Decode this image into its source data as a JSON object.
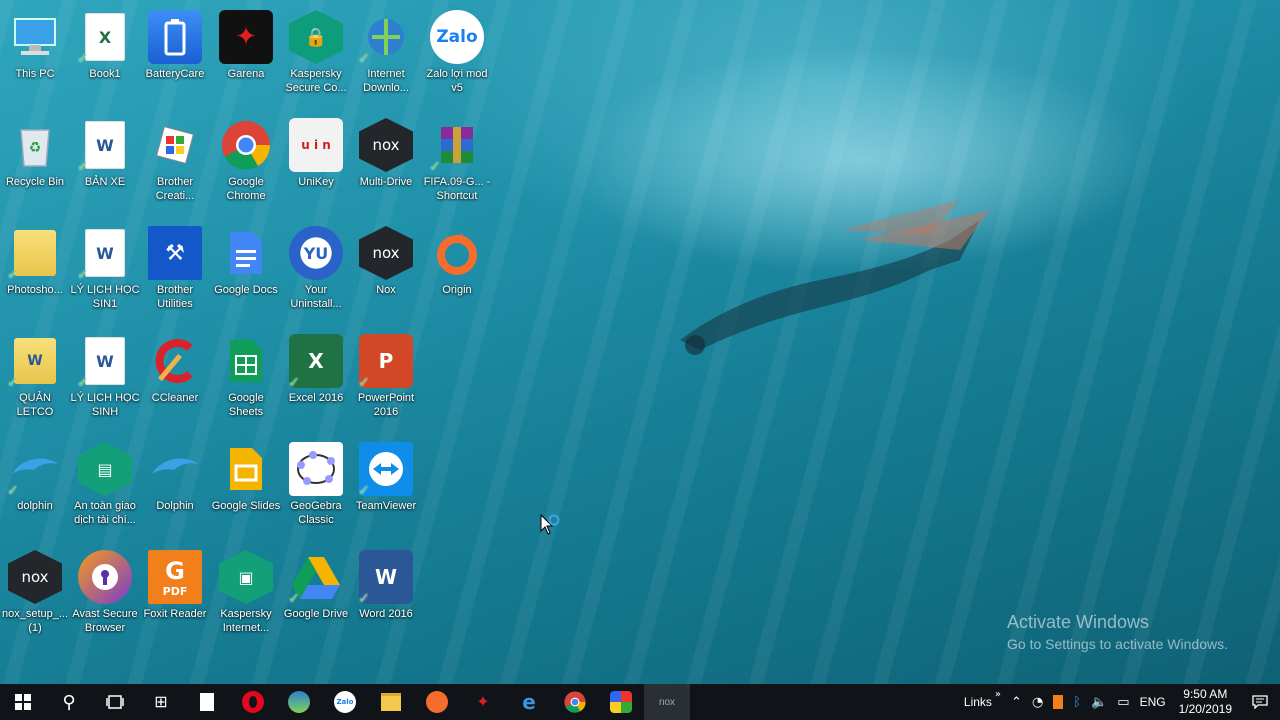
{
  "desktop": {
    "icons": [
      {
        "label": "This PC"
      },
      {
        "label": "Book1"
      },
      {
        "label": "BatteryCare"
      },
      {
        "label": "Garena"
      },
      {
        "label": "Kaspersky Secure Co..."
      },
      {
        "label": "Internet Downlo..."
      },
      {
        "label": "Zalo lợi mod v5"
      },
      {
        "label": "Recycle Bin"
      },
      {
        "label": "BẢN XE"
      },
      {
        "label": "Brother Creati..."
      },
      {
        "label": "Google Chrome"
      },
      {
        "label": "UniKey"
      },
      {
        "label": "Multi-Drive"
      },
      {
        "label": "FIFA.09-G... - Shortcut"
      },
      {
        "label": "Photosho..."
      },
      {
        "label": "LÝ LỊCH HỌC SIN1"
      },
      {
        "label": "Brother Utilities"
      },
      {
        "label": "Google Docs"
      },
      {
        "label": "Your Uninstall..."
      },
      {
        "label": "Nox"
      },
      {
        "label": "Origin"
      },
      {
        "label": "QUẢN LETCO"
      },
      {
        "label": "LÝ LỊCH HỌC SINH"
      },
      {
        "label": "CCleaner"
      },
      {
        "label": "Google Sheets"
      },
      {
        "label": "Excel 2016"
      },
      {
        "label": "PowerPoint 2016"
      },
      {
        "label": "dolphin"
      },
      {
        "label": "An toàn giao dịch tài chí..."
      },
      {
        "label": "Dolphin"
      },
      {
        "label": "Google Slides"
      },
      {
        "label": "GeoGebra Classic"
      },
      {
        "label": "TeamViewer"
      },
      {
        "label": "nox_setup_... (1)"
      },
      {
        "label": "Avast Secure Browser"
      },
      {
        "label": "Foxit Reader"
      },
      {
        "label": "Kaspersky Internet..."
      },
      {
        "label": "Google Drive"
      },
      {
        "label": "Word 2016"
      }
    ],
    "glyphs": {
      "zalo": "Zalo",
      "word": "W",
      "excel": "X",
      "powerpoint": "P",
      "nox": "nox",
      "pdf": "PDF",
      "unikey": "u i n"
    }
  },
  "watermark": {
    "title": "Activate Windows",
    "subtitle": "Go to Settings to activate Windows."
  },
  "taskbar": {
    "links_label": "Links",
    "language": "ENG",
    "time": "9:50 AM",
    "date": "1/20/2019",
    "nox_label": "nox",
    "zalo_label": "Zalo"
  },
  "colors": {
    "taskbar": "#101418",
    "accent_check": "#6cd36c"
  }
}
